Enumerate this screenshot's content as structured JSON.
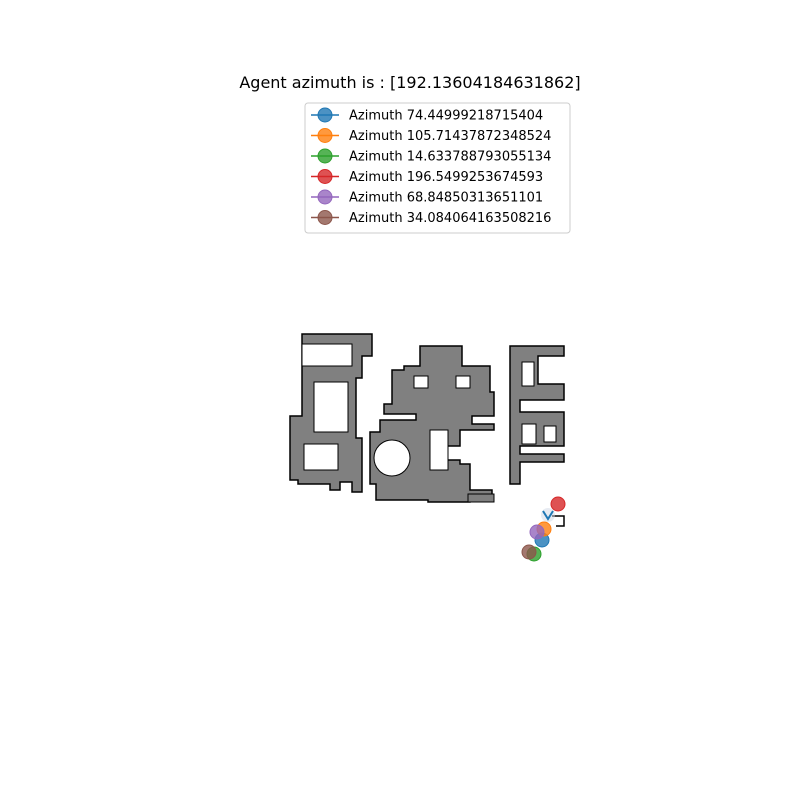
{
  "chart_data": {
    "type": "scatter",
    "title": "Agent azimuth is : [192.13604184631862]",
    "legend_position": "top-center",
    "grid": false,
    "axes_visible": false,
    "series": [
      {
        "name": "Azimuth 74.44999218715404",
        "color": "#1f77b4",
        "x": 542,
        "y": 540
      },
      {
        "name": "Azimuth 105.71437872348524",
        "color": "#ff7f0e",
        "x": 544,
        "y": 529
      },
      {
        "name": "Azimuth 14.633788793055134",
        "color": "#2ca02c",
        "x": 534,
        "y": 554
      },
      {
        "name": "Azimuth 196.5499253674593",
        "color": "#d62728",
        "x": 558,
        "y": 504
      },
      {
        "name": "Azimuth 68.84850313651101",
        "color": "#9467bd",
        "x": 537,
        "y": 532
      },
      {
        "name": "Azimuth 34.084064163508216",
        "color": "#8c564b",
        "x": 529,
        "y": 552
      }
    ],
    "agent": {
      "x": 548,
      "y": 515,
      "azimuth": 192.13604184631862,
      "color": "#1f77b4"
    }
  }
}
